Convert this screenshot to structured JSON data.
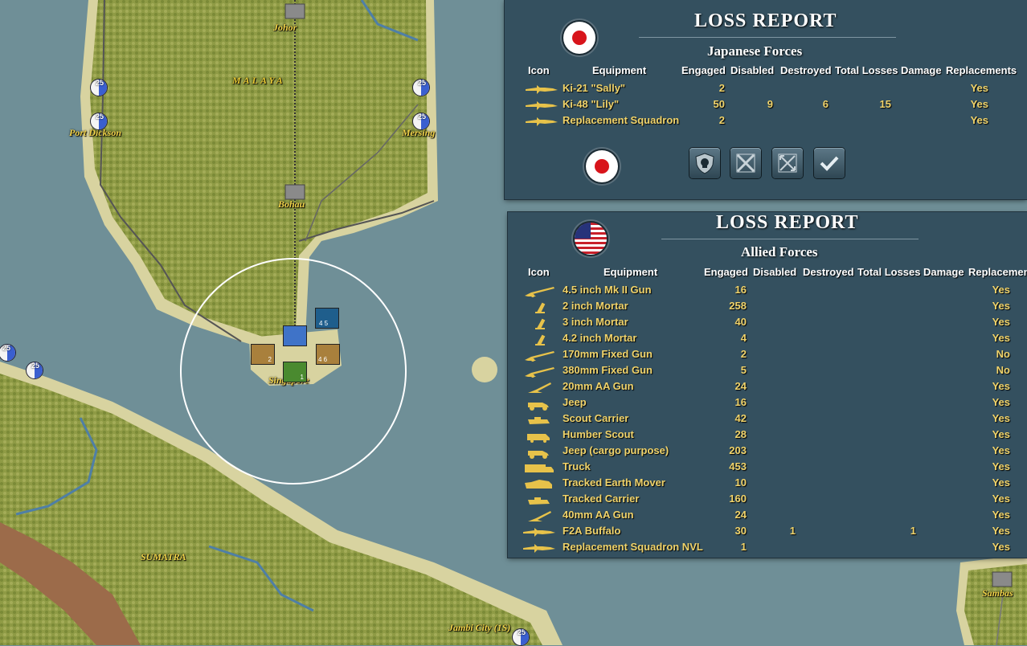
{
  "map": {
    "labels": {
      "johor": "Johor",
      "malaya": "MALAYA",
      "port_dickson": "Port Dickson",
      "mersing": "Mersing",
      "bohau": "Bohau",
      "singapore": "Singapore",
      "sumatra": "SUMATRA",
      "jambi": "Jambi City (1S)",
      "sambas": "Sambas"
    },
    "markers": [
      "25",
      "25",
      "25",
      "25",
      "25",
      "25",
      "25"
    ],
    "counters": {
      "c1": "4 5",
      "c2": "2",
      "c3": "4 6",
      "c4": "1"
    }
  },
  "japanese_report": {
    "title": "LOSS REPORT",
    "subtitle": "Japanese Forces",
    "columns": [
      "Icon",
      "Equipment",
      "Engaged",
      "Disabled",
      "Destroyed",
      "Total Losses",
      "Damage",
      "Replacements"
    ],
    "rows": [
      {
        "icon": "aircraft-icon",
        "name": "Ki-21 \"Sally\"",
        "engaged": "2",
        "disabled": "",
        "destroyed": "",
        "total": "",
        "damage": "",
        "repl": "Yes"
      },
      {
        "icon": "aircraft-icon",
        "name": "Ki-48 \"Lily\"",
        "engaged": "50",
        "disabled": "9",
        "destroyed": "6",
        "total": "15",
        "damage": "",
        "repl": "Yes"
      },
      {
        "icon": "aircraft-icon",
        "name": "Replacement Squadron",
        "engaged": "2",
        "disabled": "",
        "destroyed": "",
        "total": "",
        "damage": "",
        "repl": "Yes"
      }
    ],
    "buttons": [
      "shield-skull-icon",
      "crossed-swords-icon",
      "crossed-arrows-icon",
      "checkmark-icon"
    ]
  },
  "allied_report": {
    "title": "LOSS REPORT",
    "subtitle": "Allied Forces",
    "columns": [
      "Icon",
      "Equipment",
      "Engaged",
      "Disabled",
      "Destroyed",
      "Total Losses",
      "Damage",
      "Replacemen"
    ],
    "rows": [
      {
        "icon": "gun-icon",
        "name": "4.5 inch Mk II Gun",
        "engaged": "16",
        "disabled": "",
        "total": "",
        "repl": "Yes"
      },
      {
        "icon": "mortar-icon",
        "name": "2 inch Mortar",
        "engaged": "258",
        "disabled": "",
        "total": "",
        "repl": "Yes"
      },
      {
        "icon": "mortar-icon",
        "name": "3 inch Mortar",
        "engaged": "40",
        "disabled": "",
        "total": "",
        "repl": "Yes"
      },
      {
        "icon": "mortar-icon",
        "name": "4.2 inch Mortar",
        "engaged": "4",
        "disabled": "",
        "total": "",
        "repl": "Yes"
      },
      {
        "icon": "gun-icon",
        "name": "170mm Fixed Gun",
        "engaged": "2",
        "disabled": "",
        "total": "",
        "repl": "No"
      },
      {
        "icon": "gun-icon",
        "name": "380mm Fixed Gun",
        "engaged": "5",
        "disabled": "",
        "total": "",
        "repl": "No"
      },
      {
        "icon": "aa-gun-icon",
        "name": "20mm AA Gun",
        "engaged": "24",
        "disabled": "",
        "total": "",
        "repl": "Yes"
      },
      {
        "icon": "jeep-icon",
        "name": "Jeep",
        "engaged": "16",
        "disabled": "",
        "total": "",
        "repl": "Yes"
      },
      {
        "icon": "carrier-icon",
        "name": "Scout Carrier",
        "engaged": "42",
        "disabled": "",
        "total": "",
        "repl": "Yes"
      },
      {
        "icon": "armored-car-icon",
        "name": "Humber Scout",
        "engaged": "28",
        "disabled": "",
        "total": "",
        "repl": "Yes"
      },
      {
        "icon": "jeep-icon",
        "name": "Jeep (cargo purpose)",
        "engaged": "203",
        "disabled": "",
        "total": "",
        "repl": "Yes"
      },
      {
        "icon": "truck-icon",
        "name": "Truck",
        "engaged": "453",
        "disabled": "",
        "total": "",
        "repl": "Yes"
      },
      {
        "icon": "tracked-icon",
        "name": "Tracked Earth Mover",
        "engaged": "10",
        "disabled": "",
        "total": "",
        "repl": "Yes"
      },
      {
        "icon": "carrier-icon",
        "name": "Tracked Carrier",
        "engaged": "160",
        "disabled": "",
        "total": "",
        "repl": "Yes"
      },
      {
        "icon": "aa-gun-icon",
        "name": "40mm AA Gun",
        "engaged": "24",
        "disabled": "",
        "total": "",
        "repl": "Yes"
      },
      {
        "icon": "aircraft-icon",
        "name": "F2A Buffalo",
        "engaged": "30",
        "disabled": "1",
        "total": "1",
        "repl": "Yes"
      },
      {
        "icon": "aircraft-icon",
        "name": "Replacement Squadron NVL",
        "engaged": "1",
        "disabled": "",
        "total": "",
        "repl": "Yes"
      }
    ]
  },
  "colors": {
    "panel": "#34505f",
    "text_gold": "#f0d36a",
    "water": "#6f8f97",
    "forest": "#9aa250"
  }
}
